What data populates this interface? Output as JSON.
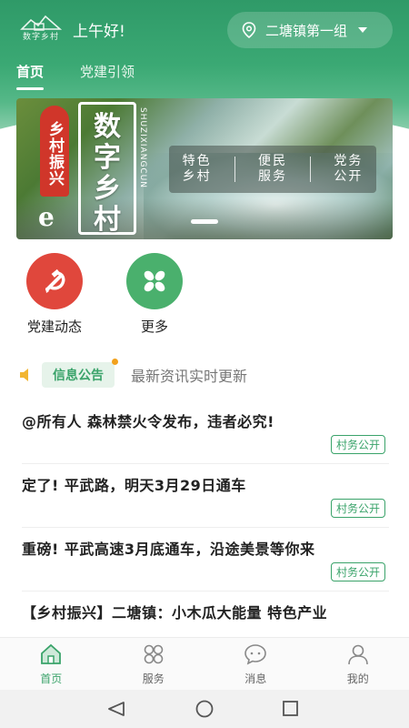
{
  "header": {
    "logo_text": "数字乡村",
    "greeting": "上午好!",
    "location": "二塘镇第一组",
    "tabs": [
      {
        "label": "首页",
        "active": true
      },
      {
        "label": "党建引领",
        "active": false
      }
    ]
  },
  "banner": {
    "slogan_vertical": "乡村振兴",
    "slogan_main": "数字乡村",
    "slogan_pinyin": "SHUZIXIANGCUN",
    "brand_glyph": "e",
    "features": [
      "特色乡村",
      "便民服务",
      "党务公开"
    ],
    "active_slide": 1
  },
  "quick_links": [
    {
      "label": "党建动态",
      "icon": "party-emblem-icon",
      "color": "#e0473c"
    },
    {
      "label": "更多",
      "icon": "clover-icon",
      "color": "#4ab06d"
    }
  ],
  "notice": {
    "tag": "信息公告",
    "subtitle": "最新资讯实时更新"
  },
  "news": [
    {
      "title": "@所有人 森林禁火令发布，违者必究!",
      "tag": "村务公开"
    },
    {
      "title": "定了! 平武路，明天3月29日通车",
      "tag": "村务公开"
    },
    {
      "title": "重磅! 平武高速3月底通车，沿途美景等你来",
      "tag": "村务公开"
    },
    {
      "title": "【乡村振兴】二塘镇：小木瓜大能量 特色产业",
      "tag": ""
    }
  ],
  "bottom_nav": [
    {
      "label": "首页",
      "icon": "home-icon",
      "active": true
    },
    {
      "label": "服务",
      "icon": "grid-icon",
      "active": false
    },
    {
      "label": "消息",
      "icon": "message-icon",
      "active": false
    },
    {
      "label": "我的",
      "icon": "user-icon",
      "active": false
    }
  ],
  "colors": {
    "brand_green": "#3aa36a",
    "party_red": "#e0473c"
  }
}
